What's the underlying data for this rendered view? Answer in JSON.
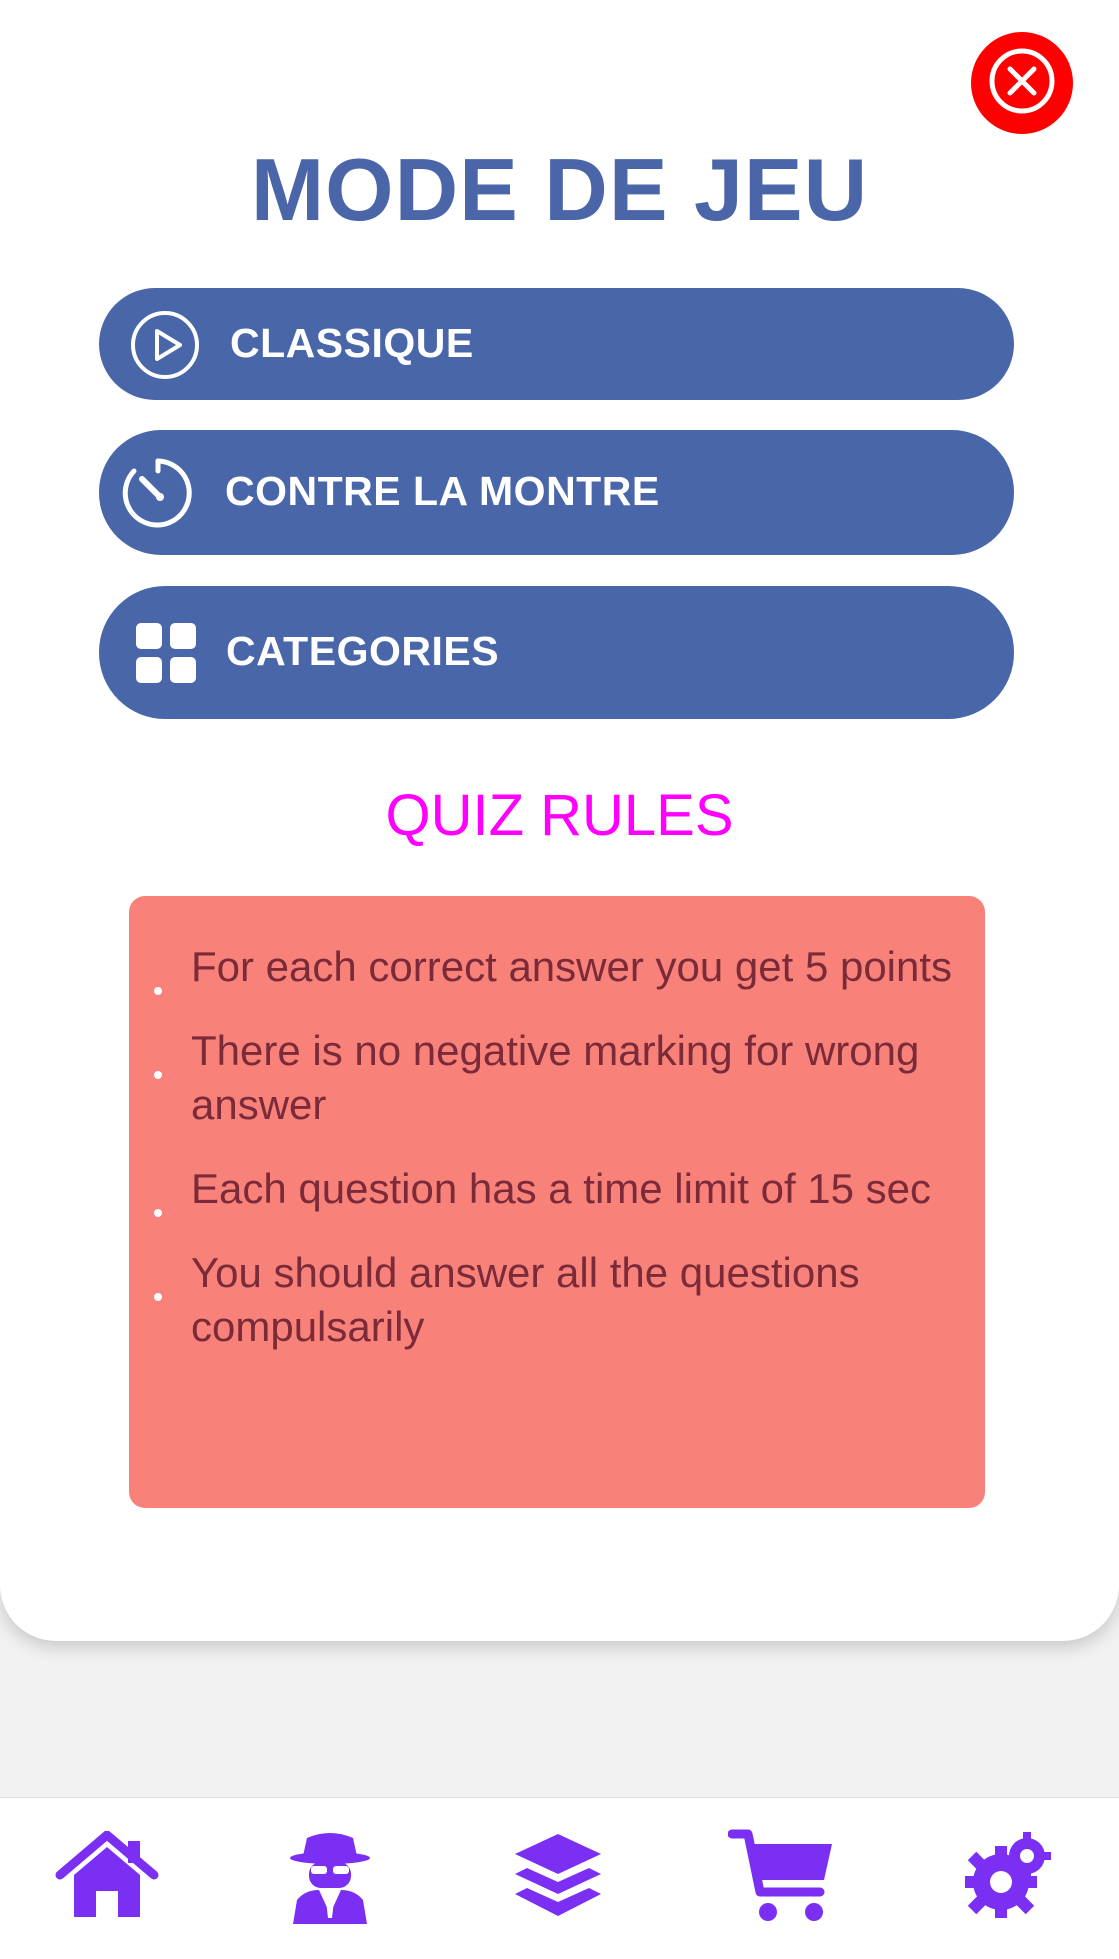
{
  "modal": {
    "title": "MODE DE JEU",
    "close_icon": "close-circle-icon",
    "modes": [
      {
        "label": "CLASSIQUE",
        "icon": "play-circle-icon"
      },
      {
        "label": "CONTRE LA MONTRE",
        "icon": "timer-icon"
      },
      {
        "label": "CATEGORIES",
        "icon": "grid-icon"
      }
    ],
    "rules_title": "QUIZ RULES",
    "rules": [
      "For each correct answer you get 5 points",
      "There is no negative marking for wrong answer",
      "Each question has a time limit of 15 sec",
      "You should answer all the questions compulsarily"
    ]
  },
  "tabbar": {
    "items": [
      {
        "icon": "home-icon"
      },
      {
        "icon": "spy-icon"
      },
      {
        "icon": "layers-icon"
      },
      {
        "icon": "cart-icon"
      },
      {
        "icon": "gear-icon"
      }
    ]
  },
  "colors": {
    "accent_blue": "#4866a8",
    "close_red": "#ff0000",
    "rules_title": "#ff00ff",
    "rules_box": "#f88279",
    "rules_text": "#7a2a38",
    "tab_icon": "#7b2ff2"
  }
}
